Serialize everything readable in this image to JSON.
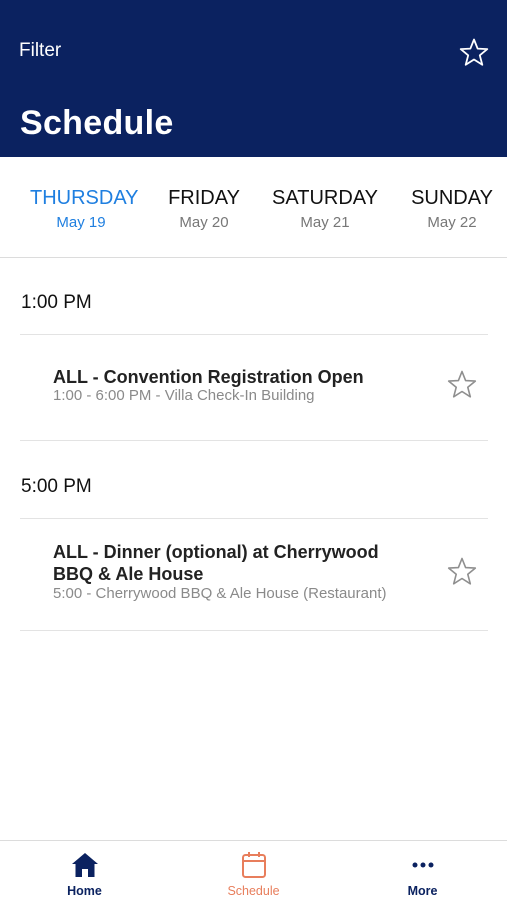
{
  "header": {
    "filter_label": "Filter",
    "title": "Schedule",
    "star_icon": "star-outline-icon"
  },
  "days": [
    {
      "name": "THURSDAY",
      "date": "May 19",
      "active": true
    },
    {
      "name": "FRIDAY",
      "date": "May 20",
      "active": false
    },
    {
      "name": "SATURDAY",
      "date": "May 21",
      "active": false
    },
    {
      "name": "SUNDAY",
      "date": "May 22",
      "active": false
    }
  ],
  "sections": [
    {
      "time": "1:00 PM",
      "events": [
        {
          "title": "ALL - Convention Registration Open",
          "subtitle": "1:00 - 6:00 PM - Villa Check-In Building"
        }
      ]
    },
    {
      "time": "5:00 PM",
      "events": [
        {
          "title": "ALL - Dinner (optional) at Cherrywood BBQ & Ale House",
          "subtitle": "5:00 - Cherrywood BBQ & Ale House (Restaurant)"
        }
      ]
    }
  ],
  "tabbar": {
    "home_label": "Home",
    "schedule_label": "Schedule",
    "more_label": "More",
    "active_tab": "Schedule"
  },
  "colors": {
    "header_bg": "#0b2260",
    "active_day": "#1f7fe0",
    "active_tab": "#e87e5c",
    "nav_dark": "#0b2260"
  }
}
